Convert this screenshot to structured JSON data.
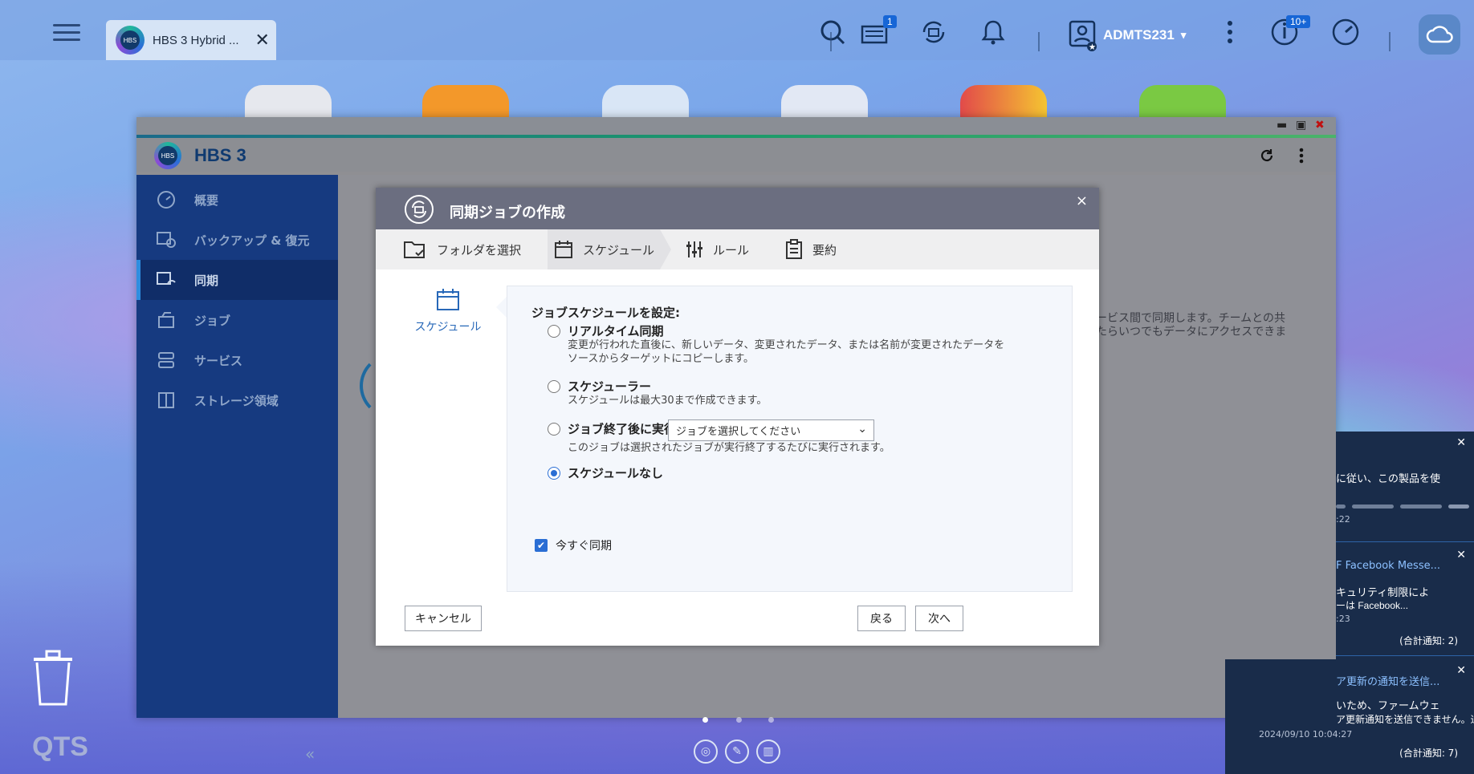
{
  "taskbar": {
    "app_tab_title": "HBS 3 Hybrid ...",
    "app_tab_logo_text": "HBS",
    "notification_badge": "1",
    "firmware_badge": "10+",
    "username": "ADMTS231",
    "user_caret": "▾"
  },
  "window": {
    "app_name": "HBS 3",
    "logo_text": "HBS",
    "minimize": "▬",
    "maximize": "▣",
    "close": "✖"
  },
  "sidebar": {
    "items": [
      {
        "label": "概要",
        "icon": "gauge-icon"
      },
      {
        "label": "バックアップ & 復元",
        "icon": "backup-restore-icon"
      },
      {
        "label": "同期",
        "icon": "sync-icon"
      },
      {
        "label": "ジョブ",
        "icon": "job-icon"
      },
      {
        "label": "サービス",
        "icon": "service-icon"
      },
      {
        "label": "ストレージ領域",
        "icon": "storage-icon"
      }
    ],
    "active": "同期",
    "collapse": "«"
  },
  "background_text": {
    "line1": "ービス間で同期します。チームとの共",
    "line2": "たらいつでもデータにアクセスできま"
  },
  "modal": {
    "title": "同期ジョブの作成",
    "close": "×",
    "steps": [
      {
        "label": "フォルダを選択"
      },
      {
        "label": "スケジュール"
      },
      {
        "label": "ルール"
      },
      {
        "label": "要約"
      }
    ],
    "left_label": "スケジュール",
    "panel_title": "ジョブスケジュールを設定:",
    "options": {
      "realtime": {
        "label": "リアルタイム同期",
        "desc1": "変更が行われた直後に、新しいデータ、変更されたデータ、または名前が変更されたデータを",
        "desc2": "ソースからターゲットにコピーします。"
      },
      "scheduler": {
        "label": "スケジューラー",
        "desc": "スケジュールは最大30まで作成できます。"
      },
      "after_job": {
        "label": "ジョブ終了後に実行:",
        "select_value": "ジョブを選択してください",
        "desc": "このジョブは選択されたジョブが実行終了するたびに実行されます。"
      },
      "none": {
        "label": "スケジュールなし"
      }
    },
    "selected_option": "none",
    "sync_now_label": "今すぐ同期",
    "sync_now_checked": true,
    "buttons": {
      "cancel": "キャンセル",
      "back": "戻る",
      "next": "次へ"
    }
  },
  "notifications": [
    {
      "line1": "に従い、この製品を使",
      "time": ":22"
    },
    {
      "link": "F Facebook Messe...",
      "line1": "キュリティ制限によ",
      "line2": "ーは Facebook...",
      "time": ":23",
      "total": "(合計通知: 2)"
    },
    {
      "link": "ア更新の通知を送信...",
      "line1": "いため、ファームウェ",
      "line2": "ア更新通知を送信できません。通知...",
      "time": "2024/09/10 10:04:27",
      "total": "(合計通知: 7)"
    }
  ],
  "desktop": {
    "brand": "QTS"
  },
  "colors": {
    "accent": "#2a6ed4",
    "sidebar": "#163a80",
    "modal_header": "#6b6e80"
  }
}
